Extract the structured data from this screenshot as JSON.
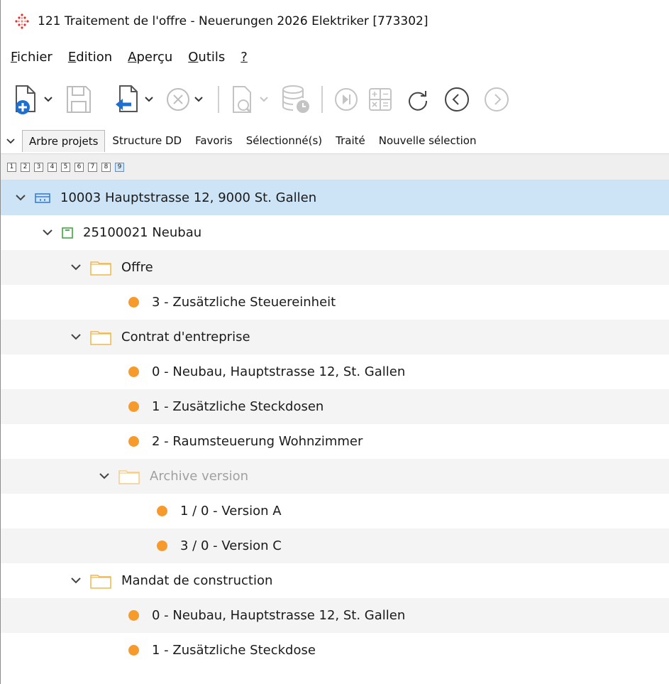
{
  "window": {
    "title": "121 Traitement de l'offre - Neuerungen 2026 Elektriker [773302]",
    "app_icon": "red-diamond-dots-icon"
  },
  "menu": [
    {
      "first": "F",
      "rest": "ichier"
    },
    {
      "first": "E",
      "rest": "dition"
    },
    {
      "first": "A",
      "rest": "perçu"
    },
    {
      "first": "O",
      "rest": "utils"
    },
    {
      "first": "?",
      "rest": ""
    }
  ],
  "tabs": {
    "items": [
      "Arbre projets",
      "Structure DD",
      "Favoris",
      "Sélectionné(s)",
      "Traité",
      "Nouvelle sélection"
    ],
    "active": "Arbre projets"
  },
  "levels": [
    "1",
    "2",
    "3",
    "4",
    "5",
    "6",
    "7",
    "8",
    "9"
  ],
  "tree": {
    "project": "10003 Hauptstrasse 12, 9000 St. Gallen",
    "object": "25100021 Neubau",
    "folder_offre": "Offre",
    "offre_items": [
      "3 - Zusätzliche Steuereinheit"
    ],
    "folder_contrat": "Contrat d'entreprise",
    "contrat_items": [
      "0 - Neubau, Hauptstrasse 12, St. Gallen",
      "1 - Zusätzliche Steckdosen",
      "2 - Raumsteuerung Wohnzimmer"
    ],
    "folder_archive": "Archive version",
    "archive_items": [
      "1 / 0 - Version A",
      "3 / 0 - Version C"
    ],
    "folder_mandat": "Mandat de construction",
    "mandat_items": [
      "0 - Neubau, Hauptstrasse 12, St. Gallen",
      "1 - Zusätzliche Steckdose"
    ]
  },
  "colors": {
    "selection": "#cde3f6",
    "status_dot": "#f79a2c",
    "folder": "#f2b64a",
    "object_icon": "#3ca83c",
    "project_icon": "#3a7fd0",
    "accent_blue": "#1f6fd1"
  }
}
